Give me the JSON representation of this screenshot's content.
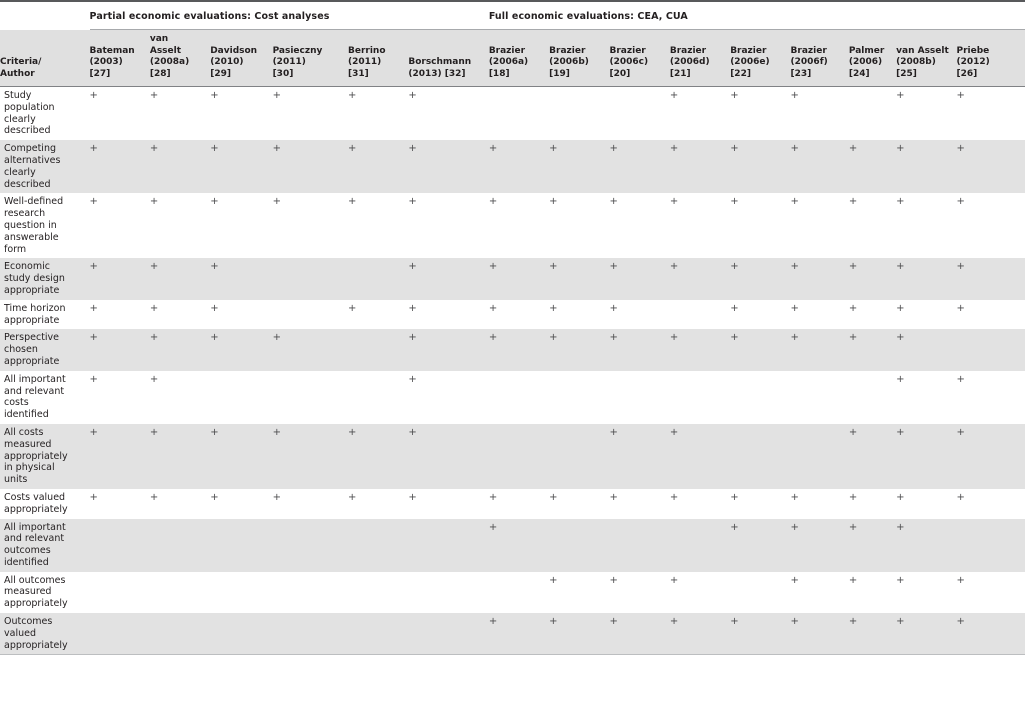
{
  "table": {
    "corner_label": "Criteria/\nAuthor",
    "corner_label_lines": [
      "Criteria/",
      "Author"
    ],
    "groups": [
      {
        "label": "Partial economic evaluations: Cost analyses",
        "span": 6
      },
      {
        "label": "Full economic evaluations: CEA, CUA",
        "span": 9
      }
    ],
    "columns": [
      {
        "id": "bateman2003",
        "lines": [
          "Bateman",
          "(2003)",
          "[27]"
        ]
      },
      {
        "id": "vanasselt2008a",
        "lines": [
          "van",
          "Asselt",
          "(2008a)",
          "[28]"
        ]
      },
      {
        "id": "davidson2010",
        "lines": [
          "Davidson",
          "(2010)",
          "[29]"
        ]
      },
      {
        "id": "pasieczny2011",
        "lines": [
          "Pasieczny",
          "(2011)",
          "[30]"
        ]
      },
      {
        "id": "berrino2011",
        "lines": [
          "Berrino",
          "(2011)",
          "[31]"
        ]
      },
      {
        "id": "borschmann2013",
        "lines": [
          "Borschmann",
          "(2013) [32]"
        ]
      },
      {
        "id": "brazier2006a",
        "lines": [
          "Brazier",
          "(2006a)",
          "[18]"
        ]
      },
      {
        "id": "brazier2006b",
        "lines": [
          "Brazier",
          "(2006b)",
          "[19]"
        ]
      },
      {
        "id": "brazier2006c",
        "lines": [
          "Brazier",
          "(2006c)",
          "[20]"
        ]
      },
      {
        "id": "brazier2006d",
        "lines": [
          "Brazier",
          "(2006d)",
          "[21]"
        ]
      },
      {
        "id": "brazier2006e",
        "lines": [
          "Brazier",
          "(2006e)",
          "[22]"
        ]
      },
      {
        "id": "brazier2006f",
        "lines": [
          "Brazier",
          "(2006f)",
          "[23]"
        ]
      },
      {
        "id": "palmer2006",
        "lines": [
          "Palmer",
          "(2006)",
          "[24]"
        ]
      },
      {
        "id": "vanasselt2008b",
        "lines": [
          "van Asselt",
          "(2008b)",
          "[25]"
        ]
      },
      {
        "id": "priebe2012",
        "lines": [
          "Priebe",
          "(2012)",
          "[26]"
        ]
      }
    ],
    "mark": "+",
    "rows": [
      {
        "criterion_lines": [
          "Study",
          "population",
          "clearly",
          "described"
        ],
        "cells": [
          "+",
          "+",
          "+",
          "+",
          "+",
          "+",
          "",
          "",
          "",
          "+",
          "+",
          "+",
          "",
          "+",
          "+"
        ]
      },
      {
        "criterion_lines": [
          "Competing",
          "alternatives",
          "clearly",
          "described"
        ],
        "cells": [
          "+",
          "+",
          "+",
          "+",
          "+",
          "+",
          "+",
          "+",
          "+",
          "+",
          "+",
          "+",
          "+",
          "+",
          "+"
        ]
      },
      {
        "criterion_lines": [
          "Well-defined",
          "research",
          "question in",
          "answerable",
          "form"
        ],
        "cells": [
          "+",
          "+",
          "+",
          "+",
          "+",
          "+",
          "+",
          "+",
          "+",
          "+",
          "+",
          "+",
          "+",
          "+",
          "+"
        ]
      },
      {
        "criterion_lines": [
          "Economic",
          "study design",
          "appropriate"
        ],
        "cells": [
          "+",
          "+",
          "+",
          "",
          "",
          "+",
          "+",
          "+",
          "+",
          "+",
          "+",
          "+",
          "+",
          "+",
          "+"
        ]
      },
      {
        "criterion_lines": [
          "Time horizon",
          "appropriate"
        ],
        "cells": [
          "+",
          "+",
          "+",
          "",
          "+",
          "+",
          "+",
          "+",
          "+",
          "",
          "+",
          "+",
          "+",
          "+",
          "+"
        ]
      },
      {
        "criterion_lines": [
          "Perspective",
          "chosen",
          "appropriate"
        ],
        "cells": [
          "+",
          "+",
          "+",
          "+",
          "",
          "+",
          "+",
          "+",
          "+",
          "+",
          "+",
          "+",
          "+",
          "+",
          ""
        ]
      },
      {
        "criterion_lines": [
          "All important",
          "and relevant",
          "costs",
          "identified"
        ],
        "cells": [
          "+",
          "+",
          "",
          "",
          "",
          "+",
          "",
          "",
          "",
          "",
          "",
          "",
          "",
          "+",
          "+"
        ]
      },
      {
        "criterion_lines": [
          "All costs",
          "measured",
          "appropriately",
          "in physical",
          "units"
        ],
        "cells": [
          "+",
          "+",
          "+",
          "+",
          "+",
          "+",
          "",
          "",
          "+",
          "+",
          "",
          "",
          "+",
          "+",
          "+"
        ]
      },
      {
        "criterion_lines": [
          "Costs valued",
          "appropriately"
        ],
        "cells": [
          "+",
          "+",
          "+",
          "+",
          "+",
          "+",
          "+",
          "+",
          "+",
          "+",
          "+",
          "+",
          "+",
          "+",
          "+"
        ]
      },
      {
        "criterion_lines": [
          "All important",
          "and relevant",
          "outcomes",
          "identified"
        ],
        "cells": [
          "",
          "",
          "",
          "",
          "",
          "",
          "+",
          "",
          "",
          "",
          "+",
          "+",
          "+",
          "+",
          ""
        ]
      },
      {
        "criterion_lines": [
          "All outcomes",
          "measured",
          "appropriately"
        ],
        "cells": [
          "",
          "",
          "",
          "",
          "",
          "",
          "",
          "+",
          "+",
          "+",
          "",
          "+",
          "+",
          "+",
          "+"
        ]
      },
      {
        "criterion_lines": [
          "Outcomes",
          "valued",
          "appropriately"
        ],
        "cells": [
          "",
          "",
          "",
          "",
          "",
          "",
          "+",
          "+",
          "+",
          "+",
          "+",
          "+",
          "+",
          "+",
          "+"
        ]
      }
    ]
  },
  "colors": {
    "shade": "#e2e2e2",
    "header_band": "#e0e0e0",
    "rule": "#58595b",
    "text": "#231f20"
  }
}
